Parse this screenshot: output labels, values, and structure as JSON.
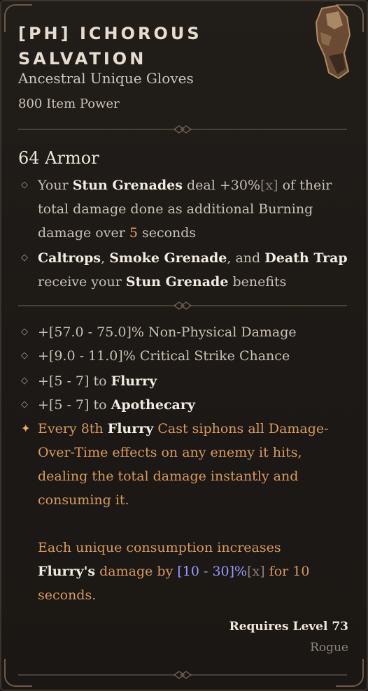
{
  "item": {
    "title": "[PH] ICHOROUS SALVATION",
    "type": "Ancestral Unique Gloves",
    "item_power": "800 Item Power",
    "armor": "64 Armor",
    "requirement": "Requires Level 73",
    "class": "Rogue"
  },
  "aspect": {
    "l1_a": "Your ",
    "l1_b": "Stun Grenades",
    "l1_c": " deal +30%",
    "l1_d": "[x]",
    "l1_e": " of their",
    "l2": "total damage done as additional Burning",
    "l3_a": "damage over ",
    "l3_b": "5",
    "l3_c": " seconds",
    "m1_a": "Caltrops",
    "m1_b": ", ",
    "m1_c": "Smoke Grenade",
    "m1_d": ", and ",
    "m1_e": "Death Trap",
    "m2_a": "receive your ",
    "m2_b": "Stun Grenade",
    "m2_c": " benefits"
  },
  "affixes": {
    "a1": "+[57.0 - 75.0]% Non-Physical Damage",
    "a2": "+[9.0 - 11.0]% Critical Strike Chance",
    "a3_a": "+[5 - 7] to ",
    "a3_b": "Flurry",
    "a4_a": "+[5 - 7] to ",
    "a4_b": "Apothecary"
  },
  "unique": {
    "u1_a": "Every 8th ",
    "u1_b": "Flurry",
    "u1_c": " Cast siphons all Damage-",
    "u2": "Over-Time effects on any enemy it hits,",
    "u3": "dealing the total damage instantly and",
    "u4": "consuming it.",
    "u5": "Each unique consumption increases",
    "u6_a": "Flurry's",
    "u6_b": " damage by ",
    "u6_c": "[10 - 30]%",
    "u6_d": "[x]",
    "u6_e": " for 10",
    "u7": "seconds."
  },
  "colors": {
    "accent": "#e5a25b",
    "unique": "#d89a5e",
    "range": "#9b9bff",
    "highlight": "#f2ebe2"
  }
}
